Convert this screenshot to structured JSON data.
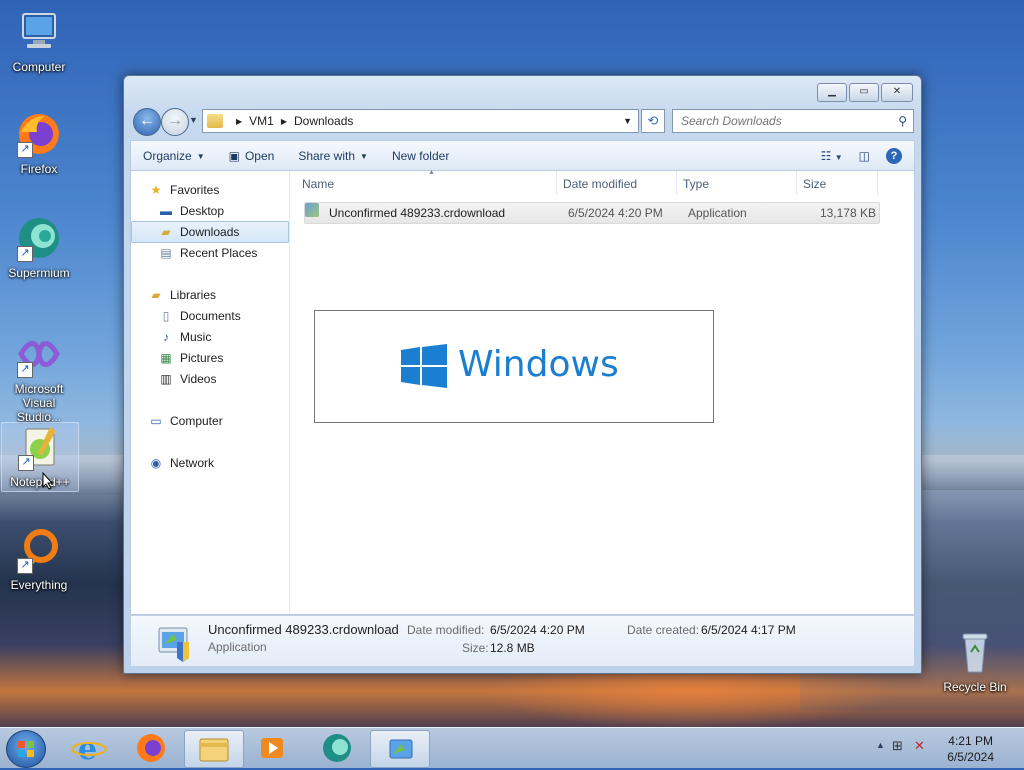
{
  "desktop": {
    "icons": [
      {
        "label": "Computer"
      },
      {
        "label": "Firefox"
      },
      {
        "label": "Supermium"
      },
      {
        "label": "Microsoft Visual Studio..."
      },
      {
        "label": "Notepad++"
      },
      {
        "label": "Everything"
      },
      {
        "label": "Recycle Bin"
      }
    ]
  },
  "window": {
    "breadcrumb": [
      "VM1",
      "Downloads"
    ],
    "search_placeholder": "Search Downloads",
    "toolbar": {
      "organize": "Organize",
      "open": "Open",
      "share_with": "Share with",
      "new_folder": "New folder"
    },
    "nav": {
      "favorites": "Favorites",
      "desktop": "Desktop",
      "downloads": "Downloads",
      "recent_places": "Recent Places",
      "libraries": "Libraries",
      "documents": "Documents",
      "music": "Music",
      "pictures": "Pictures",
      "videos": "Videos",
      "computer": "Computer",
      "network": "Network"
    },
    "columns": {
      "name": "Name",
      "date_modified": "Date modified",
      "type": "Type",
      "size": "Size"
    },
    "files": [
      {
        "name": "Unconfirmed 489233.crdownload",
        "date_modified": "6/5/2024 4:20 PM",
        "type": "Application",
        "size": "13,178 KB"
      }
    ],
    "overlay_logo_text": "Windows",
    "details": {
      "name": "Unconfirmed 489233.crdownload",
      "type": "Application",
      "date_modified_label": "Date modified:",
      "date_modified": "6/5/2024 4:20 PM",
      "size_label": "Size:",
      "size": "12.8 MB",
      "date_created_label": "Date created:",
      "date_created": "6/5/2024 4:17 PM"
    }
  },
  "taskbar": {
    "time": "4:21 PM",
    "date": "6/5/2024"
  }
}
